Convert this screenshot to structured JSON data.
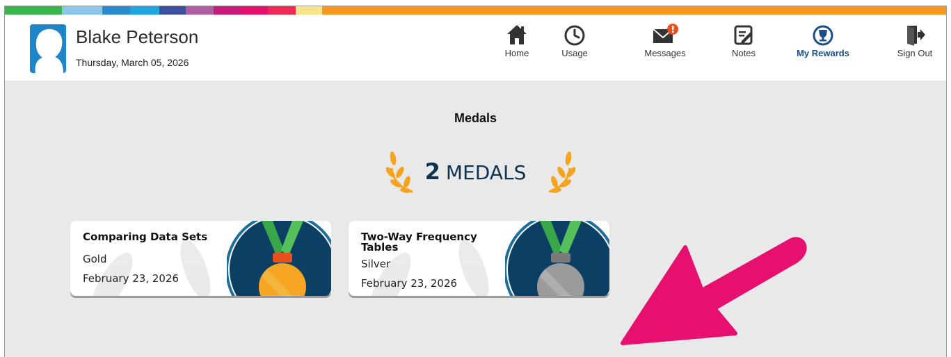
{
  "header": {
    "user_name": "Blake Peterson",
    "date": "Thursday, March 05, 2026",
    "colorbar": [
      "#3ab54a",
      "#8ec8e8",
      "#2a8ad0",
      "#1fa6e0",
      "#3f4fa0",
      "#b05ca5",
      "#c91c7a",
      "#e4116e",
      "#ee2a55",
      "#f6e48a",
      "#f7981d"
    ],
    "nav": [
      {
        "label": "Home",
        "icon": "home-icon"
      },
      {
        "label": "Usage",
        "icon": "clock-icon"
      },
      {
        "label": "Messages",
        "icon": "mail-alert-icon"
      },
      {
        "label": "Notes",
        "icon": "notes-icon"
      },
      {
        "label": "My Rewards",
        "icon": "trophy-icon",
        "active": true
      },
      {
        "label": "Sign Out",
        "icon": "sign-out-icon"
      }
    ]
  },
  "main": {
    "heading": "Medals",
    "count_number": "2",
    "count_label": "MEDALS",
    "cards": [
      {
        "title": "Comparing Data Sets",
        "level": "Gold",
        "date": "February 23, 2026",
        "medal_color": "#f7a623"
      },
      {
        "title": "Two-Way Frequency Tables",
        "level": "Silver",
        "date": "February 23, 2026",
        "medal_color": "#9b9b9b"
      }
    ]
  },
  "colors": {
    "accent_pink": "#e8106e",
    "nav_active": "#1b4f8c",
    "medal_bg": "#0b3f63",
    "ribbon_green": "#3aa64a"
  }
}
